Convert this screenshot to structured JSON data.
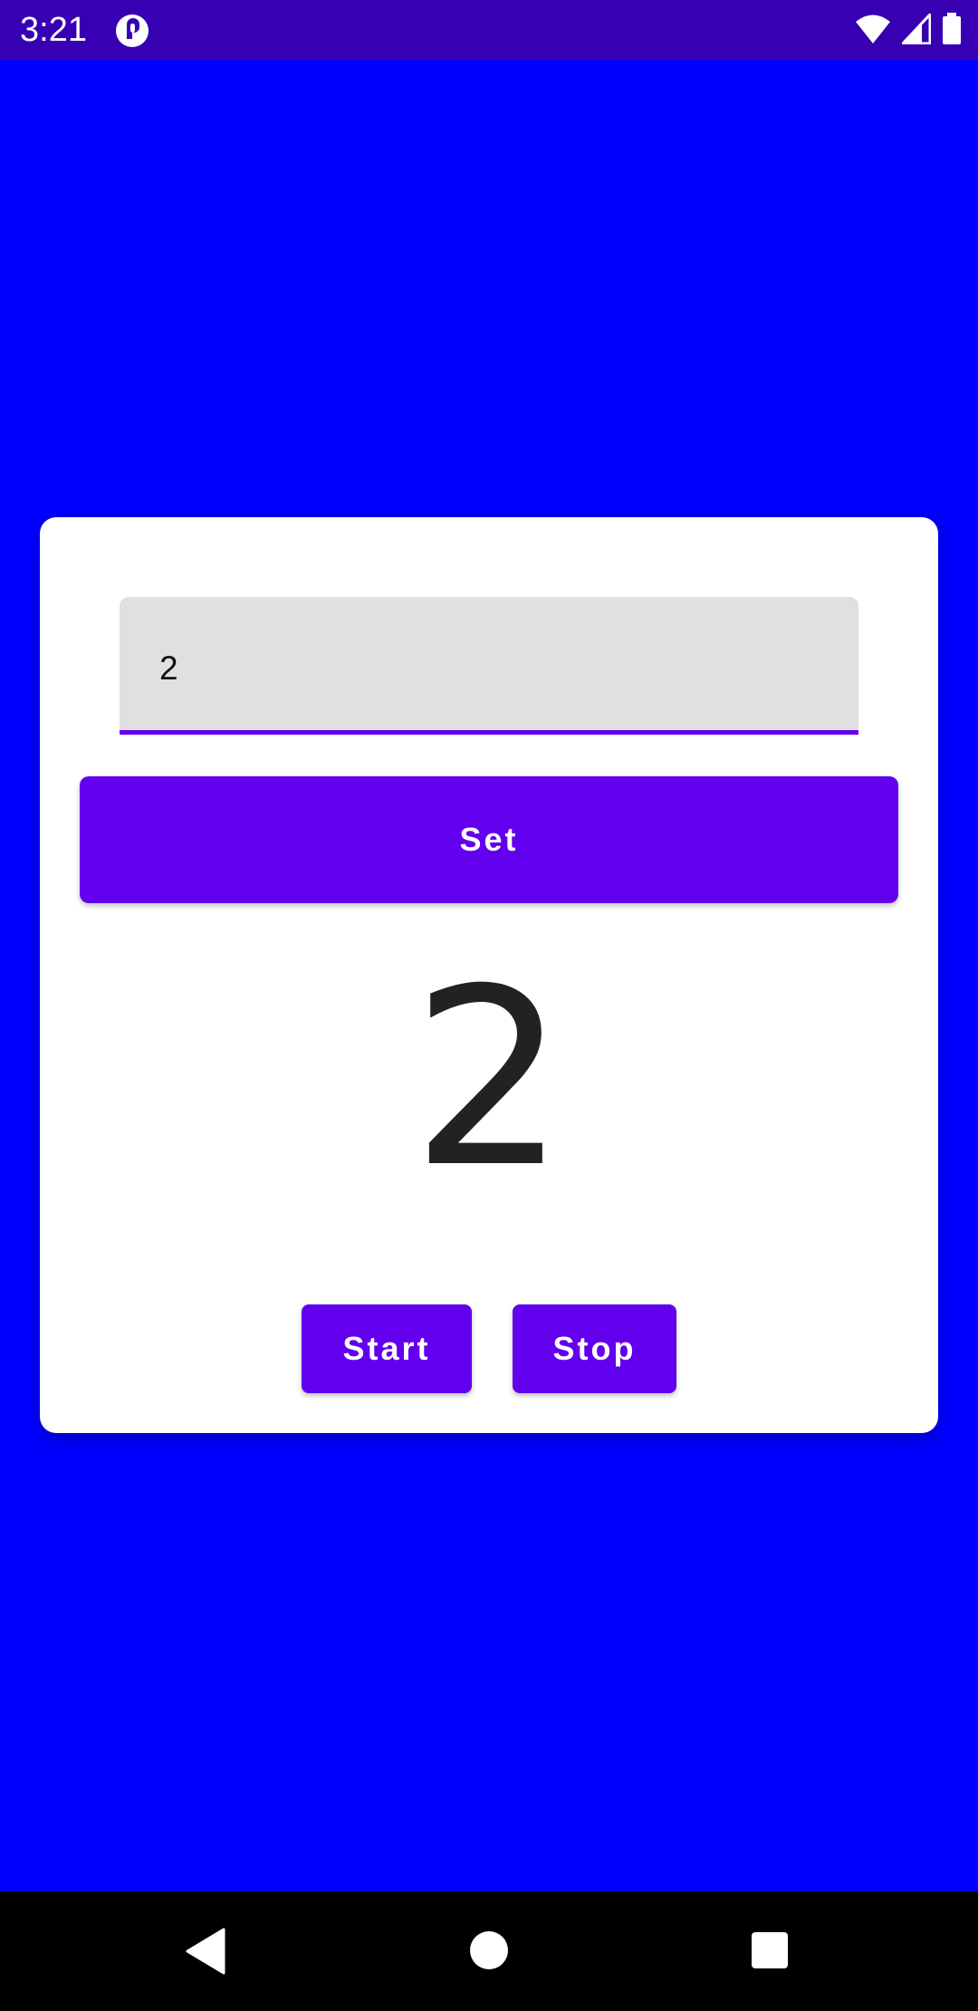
{
  "status_bar": {
    "time": "3:21",
    "app_icon": "pocket-casts-icon",
    "icons": [
      "wifi-icon",
      "signal-icon",
      "battery-icon"
    ]
  },
  "input": {
    "value": "2"
  },
  "set_button": {
    "label": "Set"
  },
  "counter": {
    "value": "2"
  },
  "start_button": {
    "label": "Start"
  },
  "stop_button": {
    "label": "Stop"
  },
  "nav_bar": {
    "icons": [
      "back-icon",
      "home-icon",
      "recents-icon"
    ]
  },
  "colors": {
    "background": "#0000FF",
    "status_bar": "#3700B3",
    "primary": "#6200EE",
    "input_fill": "#E0E0E0",
    "card": "#FFFFFF"
  }
}
